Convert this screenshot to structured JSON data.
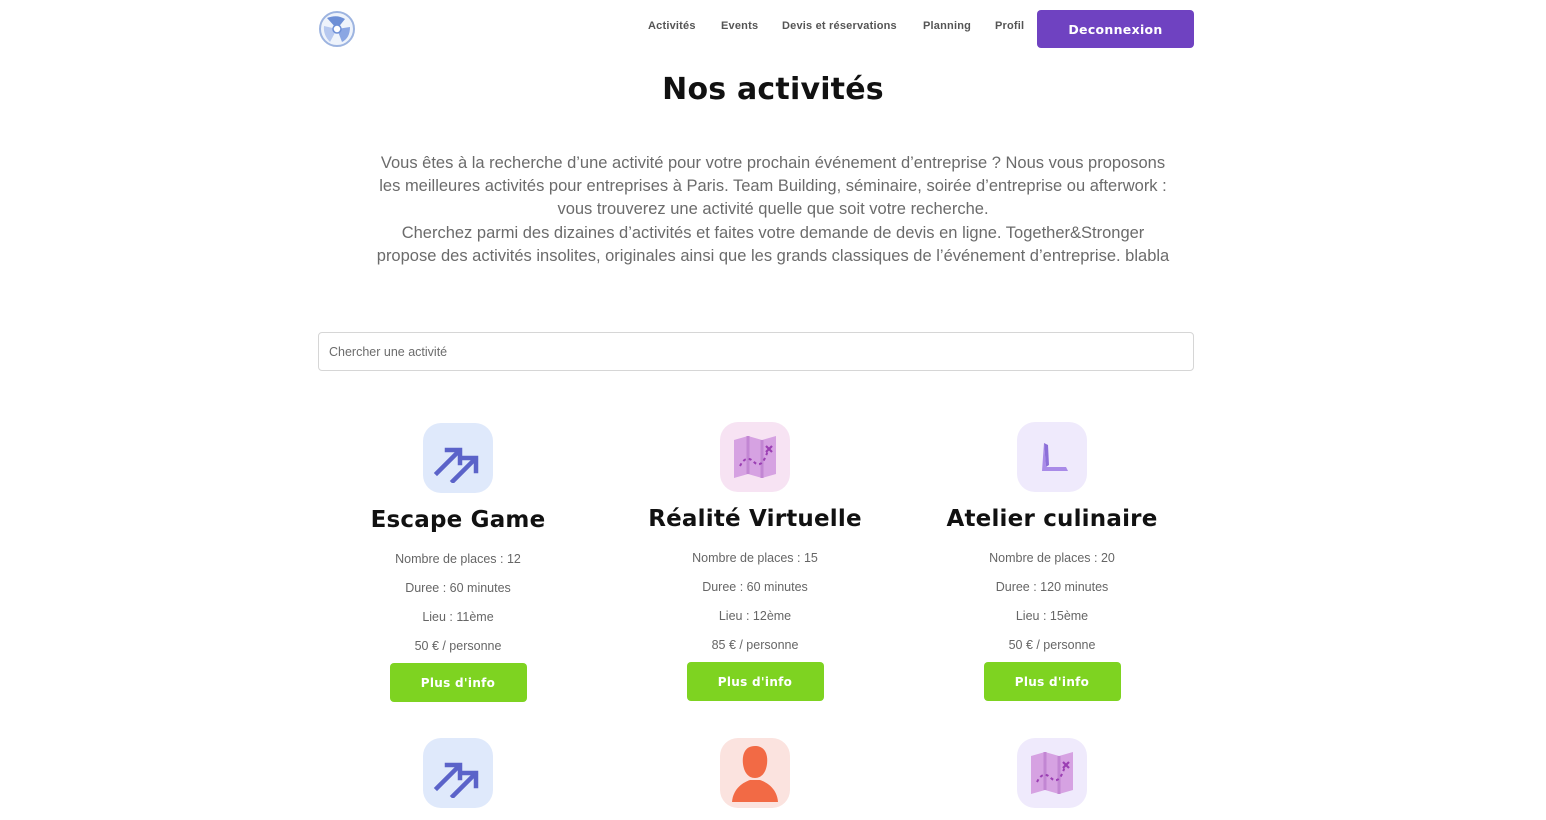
{
  "header": {
    "nav": [
      {
        "label": "Activités"
      },
      {
        "label": "Events"
      },
      {
        "label": "Devis et réservations"
      },
      {
        "label": "Planning"
      },
      {
        "label": "Profil"
      }
    ],
    "logout_label": "Deconnexion"
  },
  "main": {
    "title": "Nos activités",
    "intro_lines": [
      "Vous êtes à la recherche d’une activité pour votre prochain événement d’entreprise ? Nous vous proposons",
      "les meilleures activités pour entreprises à Paris. Team Building, séminaire, soirée d’entreprise ou afterwork :",
      "vous trouverez une activité quelle que soit votre recherche.",
      "Cherchez parmi des dizaines d’activités et faites votre demande de devis en ligne. Together&Stronger",
      "propose des activités insolites, originales ainsi que les grands classiques de l’événement d’entreprise. blabla"
    ],
    "search": {
      "placeholder": "Chercher une activité",
      "value": ""
    },
    "more_label": "Plus d'info",
    "cards": [
      {
        "icon": "trending-arrows-icon",
        "title": "Escape Game",
        "places": "Nombre de places : 12",
        "duration": "Duree : 60 minutes",
        "place": "Lieu : 11ème",
        "price": "50 € / personne"
      },
      {
        "icon": "treasure-map-icon",
        "title": "Réalité Virtuelle",
        "places": "Nombre de places : 15",
        "duration": "Duree : 60 minutes",
        "place": "Lieu : 12ème",
        "price": "85 € / personne"
      },
      {
        "icon": "clock-hands-icon",
        "title": "Atelier culinaire",
        "places": "Nombre de places : 20",
        "duration": "Duree : 120 minutes",
        "place": "Lieu : 15ème",
        "price": "50 € / personne"
      },
      {
        "icon": "trending-arrows-icon"
      },
      {
        "icon": "person-silhouette-icon"
      },
      {
        "icon": "treasure-map-icon"
      }
    ]
  },
  "colors": {
    "primary": "#6f42c1",
    "accent_green": "#7ed321",
    "icon_blue_bg": "#dfe9fb",
    "icon_pink_bg": "#f7e3f3",
    "icon_lavender_bg": "#efeafc",
    "icon_peach_bg": "#fbe3df"
  }
}
